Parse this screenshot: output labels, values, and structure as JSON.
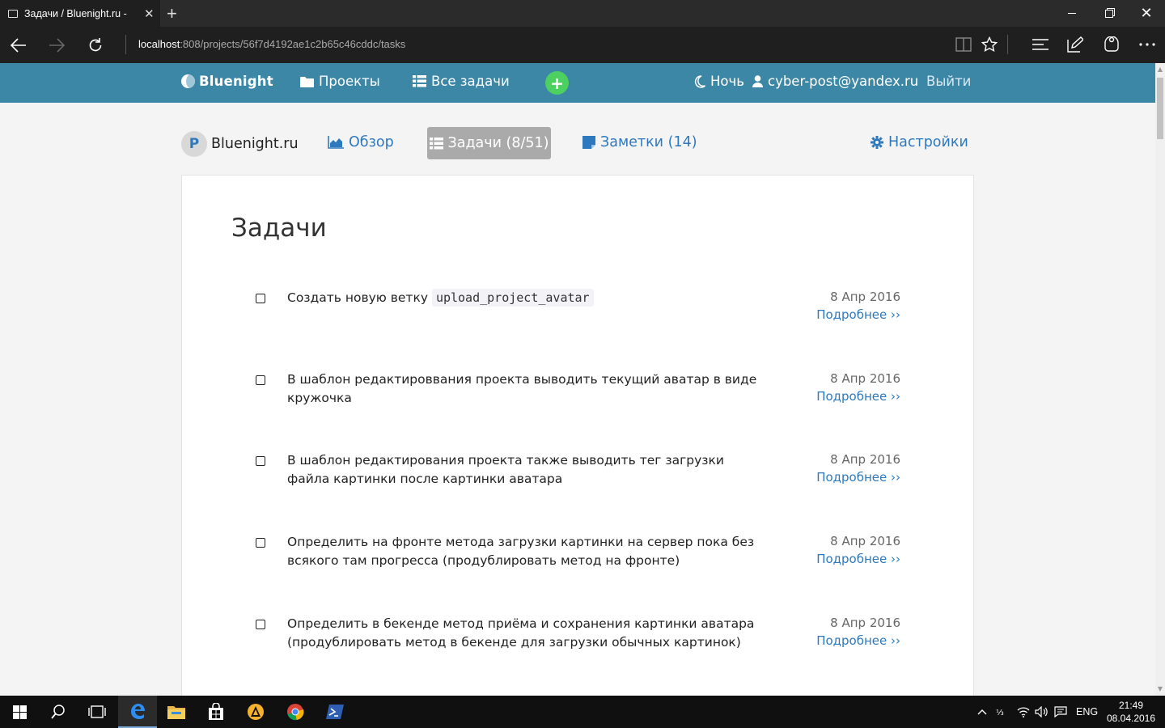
{
  "browser": {
    "tab_title": "Задачи / Bluenight.ru -",
    "tab_close": "✕",
    "new_tab": "+",
    "url_host": "localhost",
    "url_rest": ":808/projects/56f7d4192ae1c2b65c46cddc/tasks",
    "icons": {
      "back": "back-arrow-icon",
      "forward": "forward-arrow-icon",
      "reload": "reload-icon",
      "reading_view": "book-icon",
      "favorite": "star-icon",
      "hub": "hub-lines-icon",
      "web_note": "pen-note-icon",
      "share": "share-icon",
      "more": "ellipsis-icon"
    }
  },
  "header": {
    "brand": "Bluenight",
    "nav": {
      "projects": "Проекты",
      "all_tasks": "Все задачи",
      "add": "+"
    },
    "right": {
      "night": "Ночь",
      "user_email": "cyber-post@yandex.ru",
      "logout": "Выйти"
    },
    "colors": {
      "bar": "#3d87a6",
      "add_button": "#4cd05f"
    }
  },
  "project_nav": {
    "avatar_letter": "P",
    "project_name": "Bluenight.ru",
    "overview": "Обзор",
    "tasks": "Задачи (8/51)",
    "notes": "Заметки (14)",
    "settings": "Настройки",
    "colors": {
      "link": "#2e79bd",
      "active_tab": "#aaaaaa"
    }
  },
  "page": {
    "title": "Задачи"
  },
  "tasks": [
    {
      "text": "Создать новую ветку",
      "code": "upload_project_avatar",
      "date": "8 Апр 2016",
      "more": "Подробнее ››"
    },
    {
      "text": "В шаблон редактироввания проекта выводить текущий аватар в виде кружочка",
      "date": "8 Апр 2016",
      "more": "Подробнее ››"
    },
    {
      "text": "В шаблон редактирования проекта также выводить тег загрузки файла картинки после картинки аватара",
      "date": "8 Апр 2016",
      "more": "Подробнее ››"
    },
    {
      "text": "Определить на фронте метода загрузки картинки на сервер пока без всякого там прогресса (продублировать метод на фронте)",
      "date": "8 Апр 2016",
      "more": "Подробнее ››"
    },
    {
      "text": "Определить в бекенде метод приёма и сохранения картинки аватара (продублировать метод в бекенде для загрузки обычных картинок)",
      "date": "8 Апр 2016",
      "more": "Подробнее ››"
    }
  ],
  "taskbar": {
    "language": "ENG",
    "time": "21:49",
    "date": "08.04.2016"
  }
}
